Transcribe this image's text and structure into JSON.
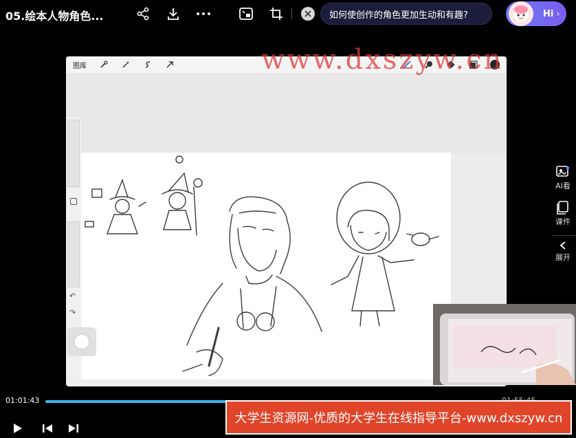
{
  "header": {
    "title": "05.绘本人物角色...",
    "share_icon": "share-icon",
    "download_icon": "download-icon",
    "more_icon": "more-icon",
    "pip_icon": "picture-in-picture-icon",
    "crop_icon": "crop-icon",
    "question": "如何使创作的角色更加生动和有趣?",
    "hi_label": "Hi"
  },
  "procreate": {
    "gallery_label": "图库"
  },
  "watermark": "www.dxszyw.cn",
  "sidebar": {
    "ai_label": "AI看",
    "courseware_label": "课件",
    "expand_label": "展开"
  },
  "player": {
    "current_time": "01:01:43",
    "total_time": "01:55:45",
    "progress": 0.349
  },
  "banner": {
    "text": "大学生资源网-优质的大学生在线指导平台-www.dxszyw.cn"
  },
  "colors": {
    "accent_progress": "#3bb8f0",
    "banner_bg": "#e0452a",
    "watermark": "#dc3c3c"
  }
}
